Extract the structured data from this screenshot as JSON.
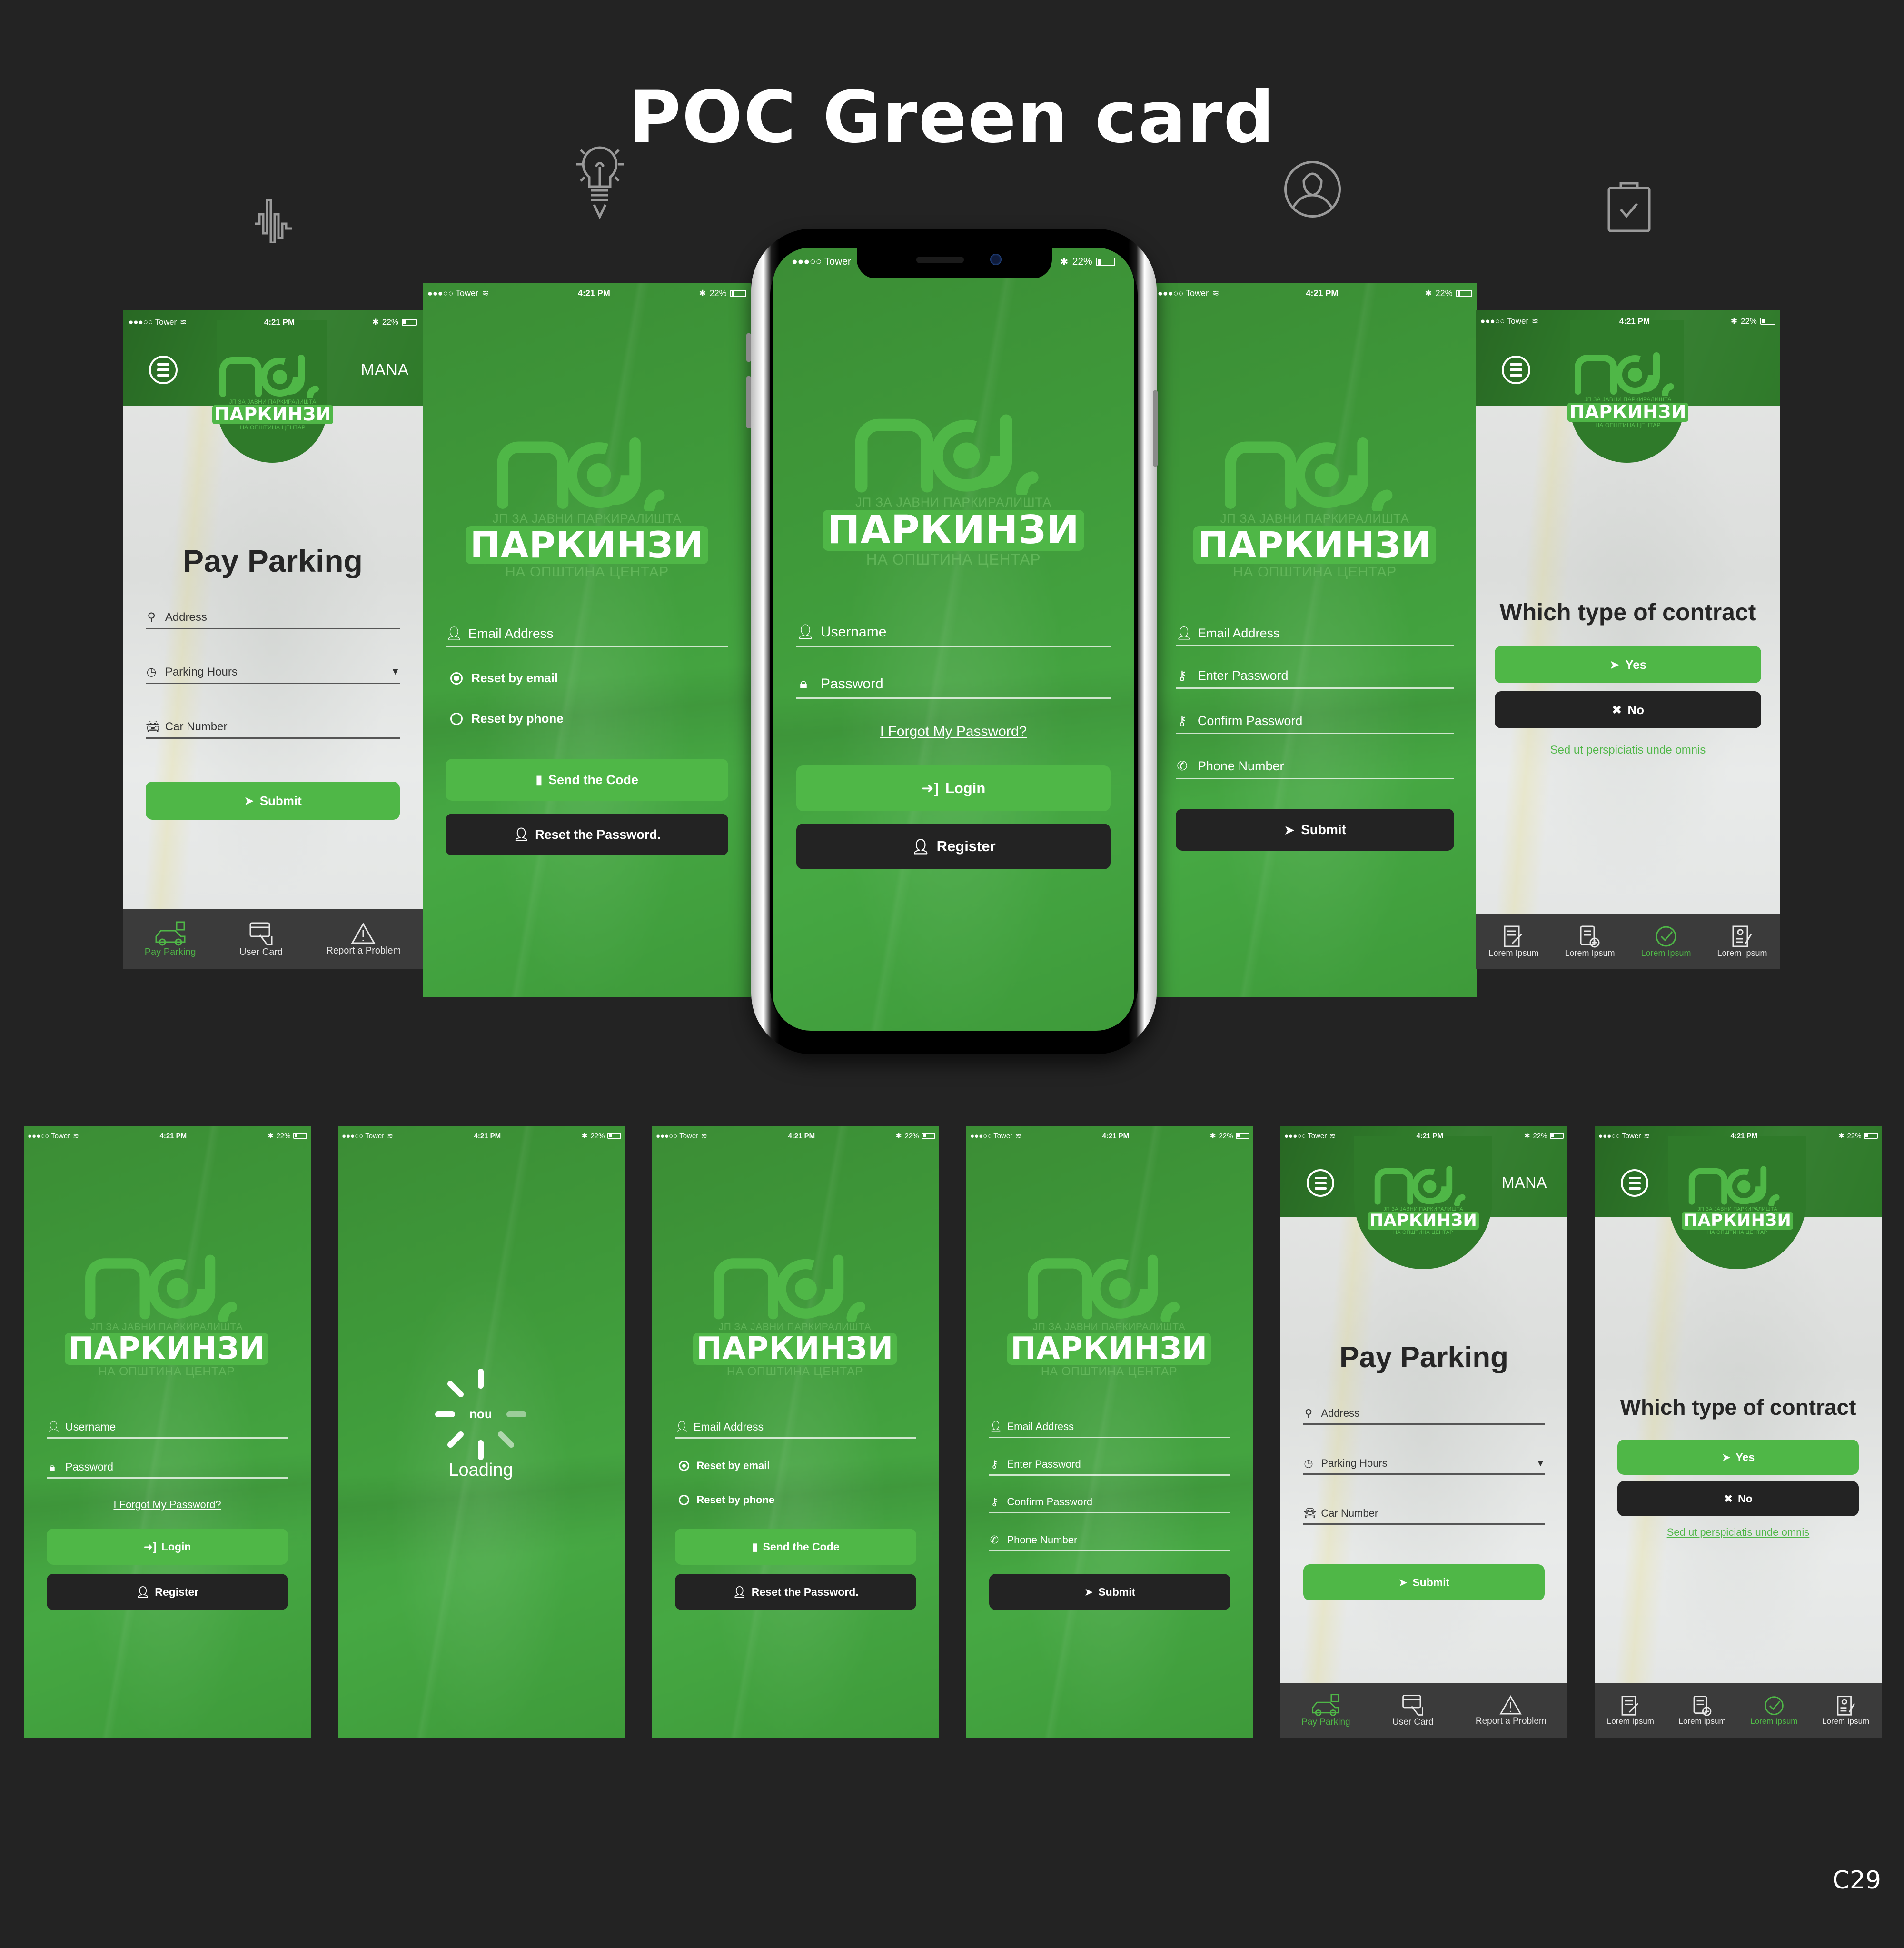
{
  "page": {
    "title": "POC Green card",
    "corner_label": "C29",
    "decorative_icons": [
      "sound-wave-icon",
      "lightbulb-idea-icon",
      "user-profile-icon",
      "clipboard-check-icon"
    ]
  },
  "colors": {
    "background": "#232323",
    "brand_green": "#4fb747",
    "header_green": "#2f7a2a",
    "dark_button": "#232323",
    "tabbar": "#3b3b3b"
  },
  "status_bar": {
    "carrier": "●●●○○ Tower",
    "time": "4:21 PM",
    "bluetooth": "✱",
    "battery": "22%"
  },
  "logo": {
    "mark": "nou",
    "subtitle_top": "ЈП ЗА ЈАВНИ ПАРКИРАЛИШТА",
    "brand": "ПАРКИНЗИ",
    "subtitle_bottom": "НА ОПШТИНА ЦЕНТАР"
  },
  "login": {
    "username_placeholder": "Username",
    "password_placeholder": "Password",
    "forgot_link": "I Forgot My Password?",
    "login_button": "Login",
    "register_button": "Register"
  },
  "reset": {
    "email_placeholder": "Email Address",
    "options": [
      {
        "label": "Reset by email",
        "selected": true
      },
      {
        "label": "Reset by phone",
        "selected": false
      }
    ],
    "send_code_button": "Send the Code",
    "reset_button": "Reset the Password."
  },
  "register": {
    "fields": [
      {
        "icon": "user-icon",
        "placeholder": "Email Address"
      },
      {
        "icon": "key-icon",
        "placeholder": "Enter Password"
      },
      {
        "icon": "key-icon",
        "placeholder": "Confirm Password"
      },
      {
        "icon": "phone-icon",
        "placeholder": "Phone Number"
      }
    ],
    "submit_button": "Submit"
  },
  "loading": {
    "label": "Loading"
  },
  "pay_parking": {
    "user_label": "MANA",
    "heading": "Pay Parking",
    "fields": [
      {
        "icon": "map-pin-icon",
        "placeholder": "Address",
        "dropdown": false
      },
      {
        "icon": "clock-icon",
        "placeholder": "Parking Hours",
        "dropdown": true
      },
      {
        "icon": "car-icon",
        "placeholder": "Car Number",
        "dropdown": false
      }
    ],
    "submit_button": "Submit",
    "tabs": [
      {
        "label": "Pay Parking",
        "icon": "car-parking-icon",
        "active": true
      },
      {
        "label": "User Card",
        "icon": "card-hand-icon",
        "active": false
      },
      {
        "label": "Report a Problem",
        "icon": "warning-icon",
        "active": false
      }
    ]
  },
  "contract": {
    "heading": "Which type of contract",
    "yes_button": "Yes",
    "no_button": "No",
    "link": "Sed ut perspiciatis unde omnis",
    "tabs": [
      {
        "label": "Lorem Ipsum",
        "icon": "document-sign-icon",
        "active": false
      },
      {
        "label": "Lorem Ipsum",
        "icon": "document-add-icon",
        "active": false
      },
      {
        "label": "Lorem Ipsum",
        "icon": "check-circle-icon",
        "active": true
      },
      {
        "label": "Lorem Ipsum",
        "icon": "profile-edit-icon",
        "active": false
      }
    ]
  }
}
